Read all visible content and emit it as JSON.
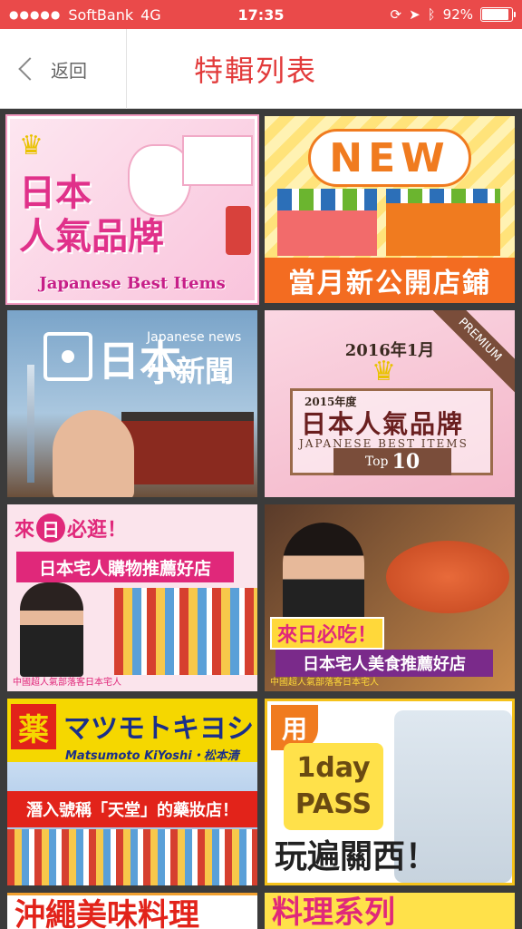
{
  "status_bar": {
    "signal": "●●●●●",
    "carrier": "SoftBank",
    "network": "4G",
    "time": "17:35",
    "battery": "92%",
    "battery_level": 0.92
  },
  "nav": {
    "back_label": "返回",
    "title": "特輯列表"
  },
  "tiles": [
    {
      "title": "日本",
      "title2": "人氣品牌",
      "subtitle": "Japanese Best Items"
    },
    {
      "badge": "NEW",
      "caption": "當月新公開店鋪"
    },
    {
      "title": "日本",
      "subtitle": "Japanese news",
      "title2": "小新聞"
    },
    {
      "year": "2016年1月",
      "ribbon": "PREMIUM",
      "year_sub": "2015年度",
      "title": "日本人氣品牌",
      "subtitle": "JAPANESE BEST ITEMS",
      "rank_label": "Top",
      "rank_value": "10"
    },
    {
      "head_a": "來",
      "head_b": "日",
      "head_c": "必逛！",
      "banner": "日本宅人購物推薦好店",
      "credit": "中國超人氣部落客日本宅人"
    },
    {
      "label1": "來日必吃！",
      "label2": "日本宅人美食推薦好店",
      "credit": "中國超人氣部落客日本宅人"
    },
    {
      "mark": "薬",
      "brand_kana": "マツモトキヨシ",
      "brand_en": "Matsumoto KiYoshi・松本清",
      "caption": "潛入號稱「天堂」的藥妝店！"
    },
    {
      "tag": "用",
      "pass_line1": "1day",
      "pass_line2": "PASS",
      "caption": "玩遍關西！"
    },
    {
      "caption": "沖繩美味料理"
    },
    {
      "caption": "料理系列"
    }
  ],
  "colors": {
    "status_bar": "#ea4a4a",
    "title_red": "#e23b3b",
    "grid_bg": "#3b3b3b"
  },
  "icons": {
    "back": "chevron-left-icon"
  }
}
